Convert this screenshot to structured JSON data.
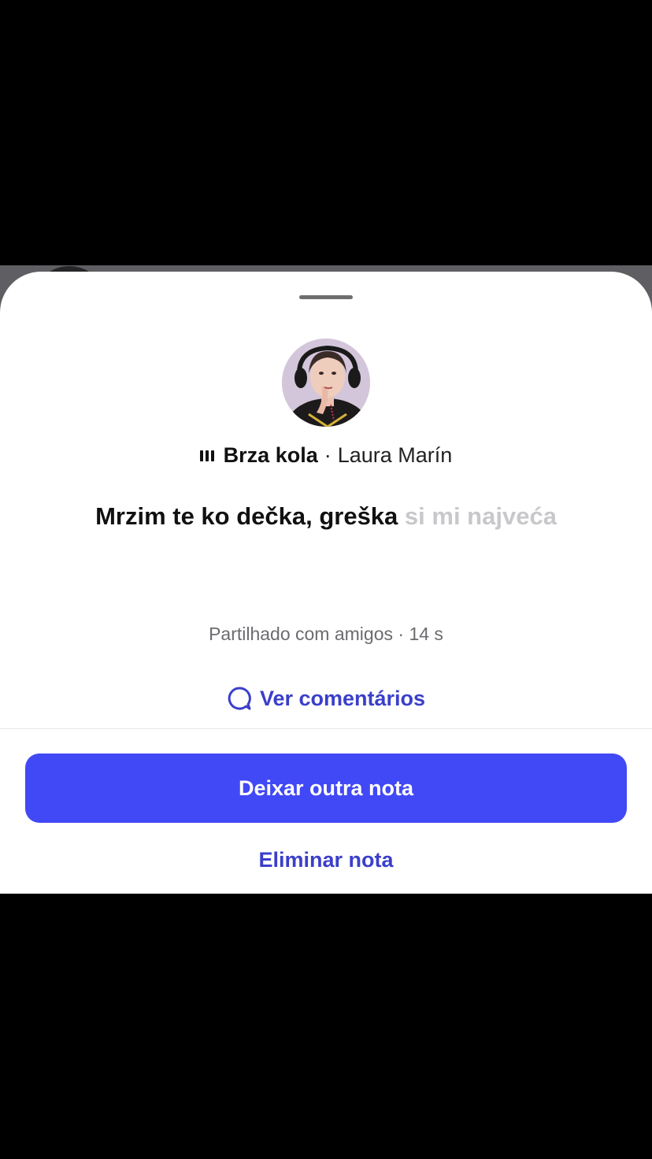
{
  "note_sheet": {
    "song": {
      "title": "Brza kola",
      "separator": "·",
      "artist": "Laura Marín"
    },
    "lyric": {
      "sung": "Mrzim te ko dečka, greška",
      "unsung": "si mi najveća"
    },
    "meta": "Partilhado com amigos · 14 s",
    "comments_label": "Ver comentários",
    "primary_button": "Deixar outra nota",
    "delete_button": "Eliminar nota"
  },
  "colors": {
    "accent": "#4148f5",
    "link": "#3b3fc9",
    "unsung_lyric": "#c8c8cc"
  },
  "icons": {
    "song": "equalizer-bars-icon",
    "comments": "speech-bubble-icon"
  }
}
